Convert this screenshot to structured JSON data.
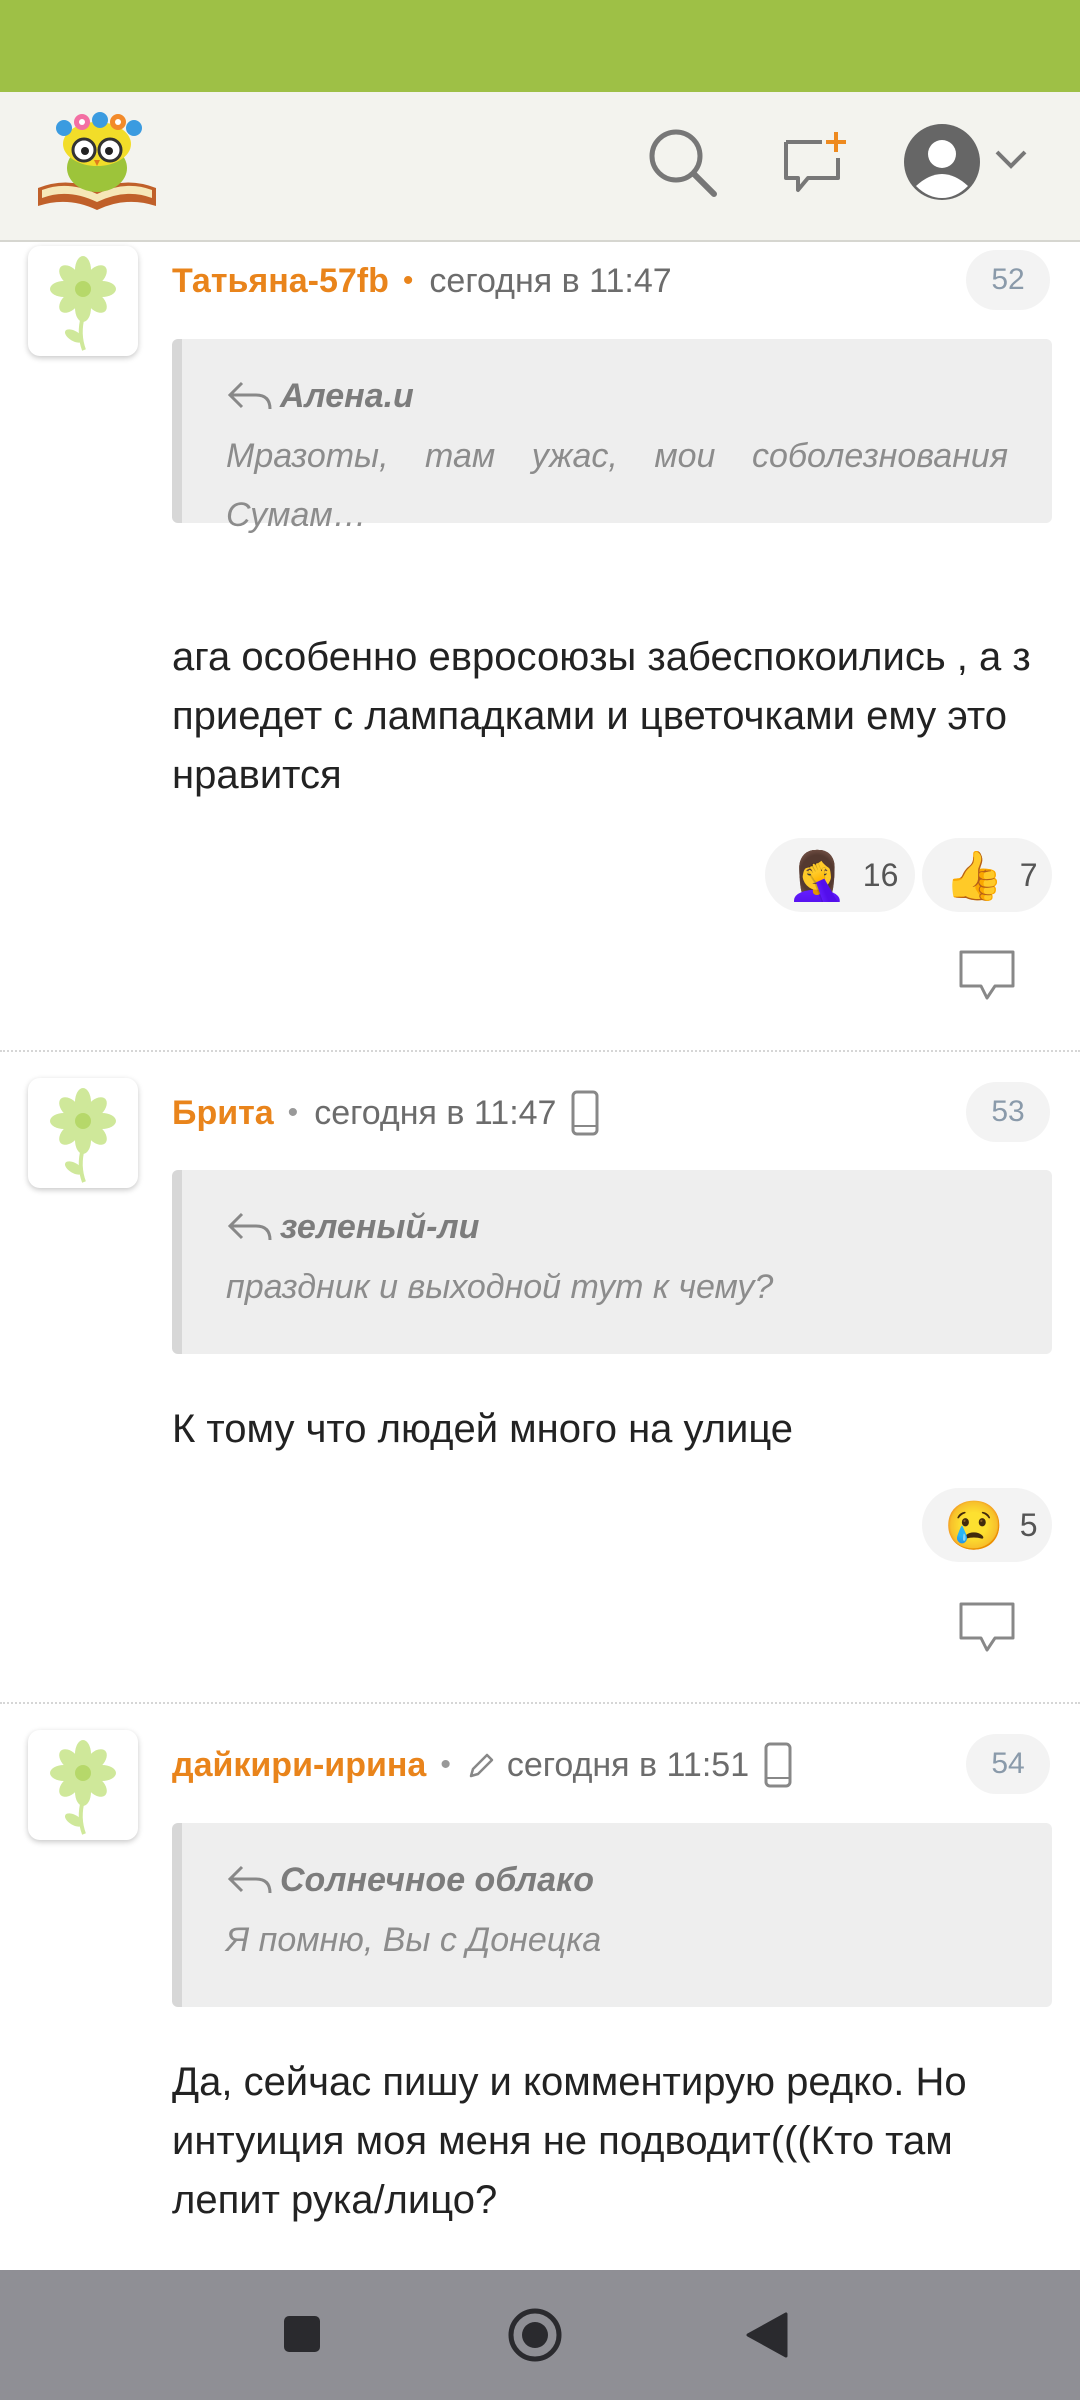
{
  "app": {
    "brand_colors": {
      "status_bar": "#9ec046",
      "accent": "#e9841b",
      "nav_bar": "#8f8f95"
    }
  },
  "header": {
    "logo": "owl-with-flowers-on-book-logo",
    "icons": [
      "search-icon",
      "new-message-icon",
      "user-avatar-icon",
      "chevron-down-icon"
    ]
  },
  "comments": [
    {
      "author": "Татьяна-57fb",
      "time": "сегодня в 11:47",
      "number": "52",
      "quote_author": "Алена.и",
      "quote_text": "Мразоты, там ужас, мои соболезнования Сумам…",
      "text": "ага особенно евросоюзы забеспокоились , а з приедет с лампадками и цветочками ему это нравится",
      "reactions": [
        {
          "emoji": "🤦‍♀️",
          "count": "16"
        },
        {
          "emoji": "👍",
          "count": "7"
        }
      ]
    },
    {
      "author": "Брита",
      "time": "сегодня в 11:47",
      "number": "53",
      "quote_author": "зеленый-ли",
      "quote_text": "праздник и выходной тут к чему?",
      "text": "К тому что людей много на улице",
      "reactions": [
        {
          "emoji": "😢",
          "count": "5"
        }
      ]
    },
    {
      "author": "дайкири-ирина",
      "time": "сегодня в 11:51",
      "number": "54",
      "quote_author": "Солнечное облако",
      "quote_text": "Я помню, Вы с Донецка",
      "text": "Да, сейчас пишу и комментирую редко. Но интуиция моя меня не подводит(((Кто там лепит рука/лицо?"
    }
  ],
  "navbar": {
    "icons": [
      "recent-apps-icon",
      "home-icon",
      "back-icon"
    ]
  }
}
